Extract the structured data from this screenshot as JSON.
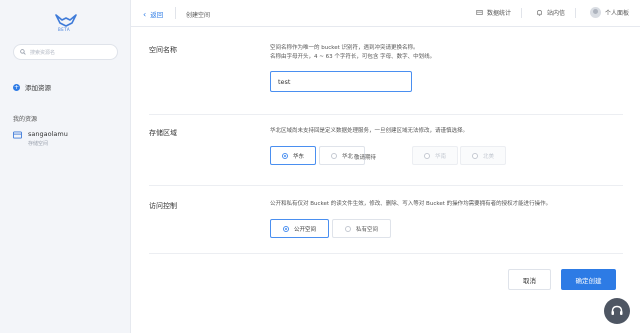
{
  "sidebar": {
    "logo_text": "BETA",
    "search_placeholder": "搜索资源名",
    "add_resource": "添加资源",
    "my_resources": "我的资源",
    "bucket": {
      "name": "sangaolamu",
      "type": "存储空间"
    }
  },
  "topbar": {
    "back": "返回",
    "breadcrumb": "创建空间",
    "stats": "数据统计",
    "messages": "站内信",
    "profile": "个人面板"
  },
  "form": {
    "name_section": {
      "label": "空间名称",
      "desc1": "空间名称作为唯一的 bucket 识别符，遇到冲突请更换名称。",
      "desc2": "名称由字母开头，4 ~ 63 个字符长，可包含 字母、数字、中划线。",
      "value": "test"
    },
    "region_section": {
      "label": "存储区域",
      "desc": "华北区域尚未支持回是定义数据处理服务，一旦创建区域无法修改，请谨慎选择。",
      "options": [
        "华东",
        "华北"
      ],
      "selected": "华东",
      "coming_label": "敬请期待",
      "coming_options": [
        "华南",
        "北美"
      ]
    },
    "access_section": {
      "label": "访问控制",
      "desc": "公开和私有仅对 Bucket 的读文件生效，修改、删除、写入等对 Bucket 的操作均需要拥有者的授权才能进行操作。",
      "options": [
        "公开空间",
        "私有空间"
      ],
      "selected": "公开空间"
    }
  },
  "actions": {
    "cancel": "取消",
    "confirm": "确定创建"
  },
  "colors": {
    "accent": "#2d7be5",
    "sidebar_bg": "#f3f5f9",
    "help_bg": "#4e5663"
  }
}
